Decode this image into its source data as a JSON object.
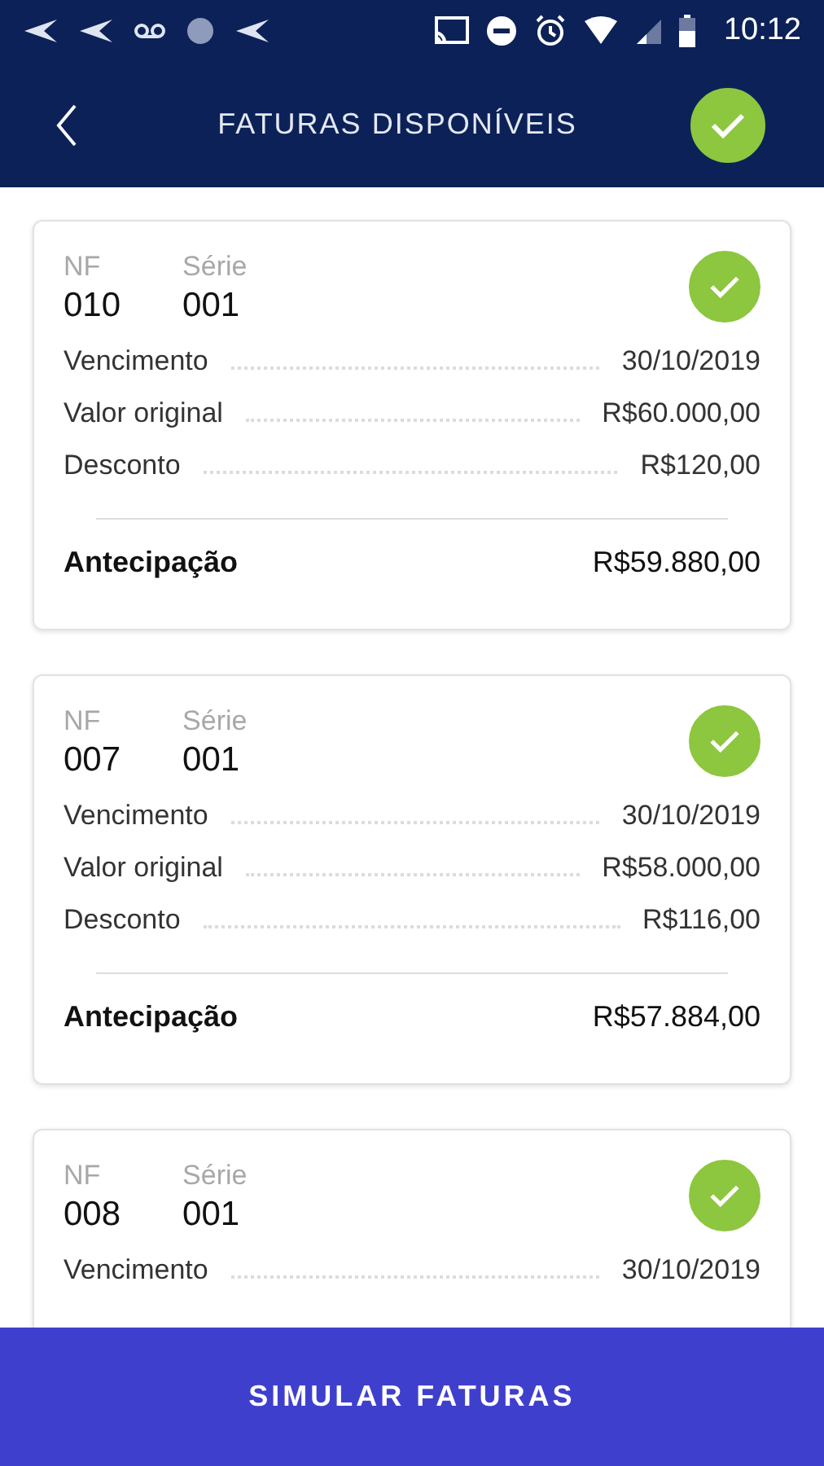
{
  "status_bar": {
    "time": "10:12"
  },
  "header": {
    "title": "FATURAS DISPONÍVEIS",
    "all_selected": true
  },
  "invoices": [
    {
      "nf_label": "NF",
      "nf": "010",
      "serie_label": "Série",
      "serie": "001",
      "selected": true,
      "rows": [
        {
          "label": "Vencimento",
          "value": "30/10/2019"
        },
        {
          "label": "Valor original",
          "value": "R$60.000,00"
        },
        {
          "label": "Desconto",
          "value": "R$120,00"
        }
      ],
      "total": {
        "label": "Antecipação",
        "value": "R$59.880,00"
      }
    },
    {
      "nf_label": "NF",
      "nf": "007",
      "serie_label": "Série",
      "serie": "001",
      "selected": true,
      "rows": [
        {
          "label": "Vencimento",
          "value": "30/10/2019"
        },
        {
          "label": "Valor original",
          "value": "R$58.000,00"
        },
        {
          "label": "Desconto",
          "value": "R$116,00"
        }
      ],
      "total": {
        "label": "Antecipação",
        "value": "R$57.884,00"
      }
    },
    {
      "nf_label": "NF",
      "nf": "008",
      "serie_label": "Série",
      "serie": "001",
      "selected": true,
      "rows": [
        {
          "label": "Vencimento",
          "value": "30/10/2019"
        }
      ]
    }
  ],
  "action_button": "SIMULAR FATURAS"
}
